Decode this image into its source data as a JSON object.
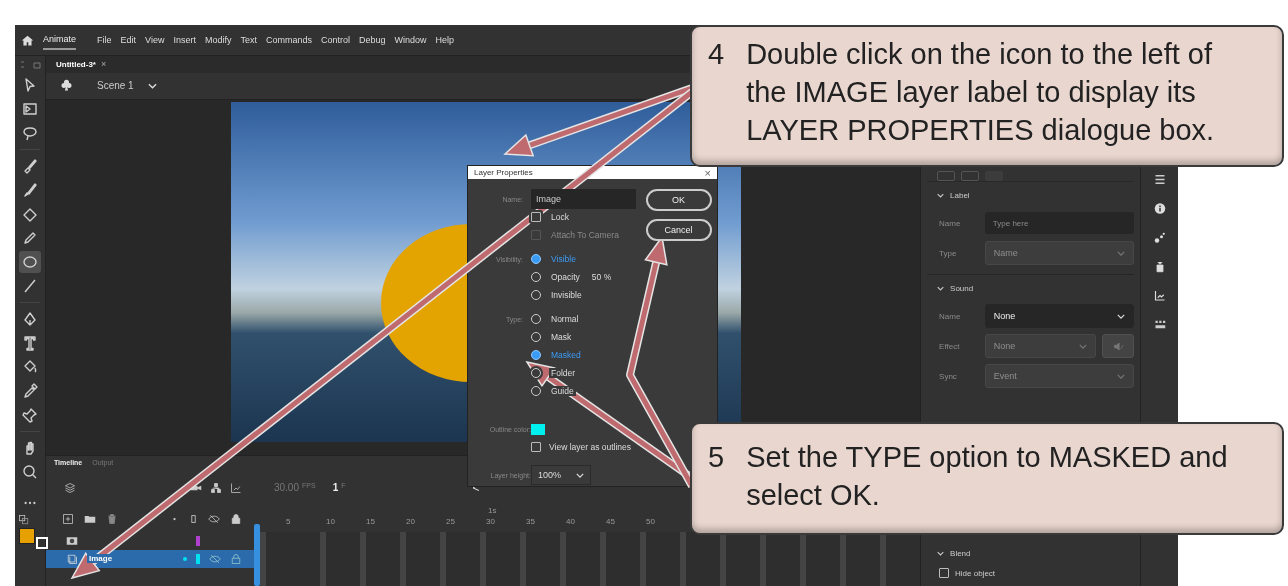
{
  "menu_bar": {
    "workspace": "Animate",
    "menus": [
      "File",
      "Edit",
      "View",
      "Insert",
      "Modify",
      "Text",
      "Commands",
      "Control",
      "Debug",
      "Window",
      "Help"
    ]
  },
  "document_tab": {
    "title": "Untitled-3*",
    "close": "×"
  },
  "scene_bar": {
    "scene": "Scene 1"
  },
  "tools": [
    {
      "kind": "subselect",
      "selected": false
    },
    {
      "kind": "transform",
      "selected": false
    },
    {
      "kind": "lasso",
      "selected": false
    },
    {
      "kind": "paintbrush",
      "selected": false
    },
    {
      "kind": "brush",
      "selected": false
    },
    {
      "kind": "eraser",
      "selected": false
    },
    {
      "kind": "pencil",
      "selected": false
    },
    {
      "kind": "oval",
      "selected": true
    },
    {
      "kind": "line",
      "selected": false
    },
    {
      "kind": "pen",
      "selected": false
    },
    {
      "kind": "text",
      "selected": false
    },
    {
      "kind": "bucket",
      "selected": false
    },
    {
      "kind": "eyedropper",
      "selected": false
    },
    {
      "kind": "pin",
      "selected": false
    },
    {
      "kind": "hand",
      "selected": false
    },
    {
      "kind": "zoom",
      "selected": false
    }
  ],
  "dialog": {
    "title": "Layer Properties",
    "close": "×",
    "name_label": "Name:",
    "name_value": "Image",
    "buttons": [
      "OK",
      "Cancel"
    ],
    "lock": {
      "label": "Lock",
      "checked": false,
      "disabled": false
    },
    "attach_camera": {
      "label": "Attach To Camera",
      "checked": false,
      "disabled": true
    },
    "visibility": {
      "label": "Visibility:",
      "options": [
        {
          "label": "Visible",
          "selected": true
        },
        {
          "label": "Opacity",
          "selected": false,
          "value": "50 %"
        },
        {
          "label": "Invisible",
          "selected": false
        }
      ]
    },
    "type": {
      "label": "Type:",
      "options": [
        {
          "label": "Normal",
          "selected": false
        },
        {
          "label": "Mask",
          "selected": false
        },
        {
          "label": "Masked",
          "selected": true
        },
        {
          "label": "Folder",
          "selected": false
        },
        {
          "label": "Guide",
          "selected": false
        }
      ]
    },
    "outline_color": {
      "label": "Outline color:"
    },
    "view_outlines": {
      "label": "View layer as outlines",
      "checked": false,
      "disabled": false
    },
    "layer_height": {
      "label": "Layer height:",
      "value": "100%"
    }
  },
  "timeline": {
    "tabs": [
      {
        "label": "Timeline",
        "selected": true
      },
      {
        "label": "Output",
        "selected": false
      }
    ],
    "fps": "30.00",
    "fps_unit": "FPS",
    "frame": "1",
    "frame_unit": "F",
    "nav": "<",
    "seconds_marker": "1s",
    "frame_numbers": [
      "5",
      "10",
      "15",
      "20",
      "25",
      "30",
      "35",
      "40",
      "45",
      "50"
    ],
    "layers": [
      {
        "kind": "mask",
        "selected": false,
        "color": "#b040d0"
      },
      {
        "kind": "masked",
        "name": "Image",
        "selected": true,
        "color": "#00e0f0"
      }
    ]
  },
  "properties": {
    "sections": [
      {
        "title": "Label",
        "expanded": true,
        "rows": [
          {
            "label": "Name",
            "kind": "field",
            "placeholder": "Type here",
            "disabled": false
          },
          {
            "label": "Type",
            "kind": "dropdown",
            "value": "Name",
            "disabled": true
          }
        ]
      },
      {
        "title": "Sound",
        "expanded": true,
        "rows": [
          {
            "label": "Name",
            "kind": "dropdown",
            "value": "None",
            "disabled": false
          },
          {
            "label": "Effect",
            "kind": "dropdown_button",
            "value": "None",
            "disabled": true
          },
          {
            "label": "Sync",
            "kind": "dropdown",
            "value": "Event",
            "disabled": true
          }
        ]
      },
      {
        "title": "Blend",
        "expanded": true,
        "rows": [
          {
            "label": "Hide object",
            "kind": "checkbox",
            "checked": false
          }
        ]
      }
    ]
  },
  "callouts": [
    {
      "number": "4",
      "text": "Double click on the icon to the left of the IMAGE layer label to display its LAYER PROPERTIES dialogue box."
    },
    {
      "number": "5",
      "text": "Set the TYPE option to MASKED and select OK."
    }
  ]
}
